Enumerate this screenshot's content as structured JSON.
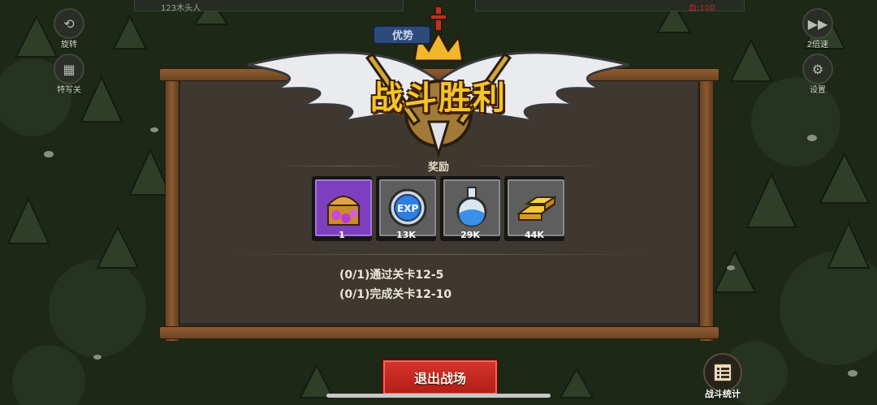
{
  "hud": {
    "player_name": "123木头人",
    "enemy_hp_text": "血:100",
    "left_buttons": [
      {
        "label": "旋转",
        "icon": "rotate-icon"
      },
      {
        "label": "特写关",
        "icon": "film-icon"
      }
    ],
    "right_buttons": [
      {
        "label": "2倍速",
        "icon": "fast-forward-icon"
      },
      {
        "label": "设置",
        "icon": "gear-icon"
      }
    ],
    "banner_text": "优势"
  },
  "victory": {
    "title": "战斗胜利"
  },
  "rewards": {
    "title": "奖励",
    "items": [
      {
        "icon": "treasure-chest-icon",
        "count": "1",
        "frame": "#8d4fd3"
      },
      {
        "icon": "exp-icon",
        "count": "13K",
        "frame": "#6c6c6c"
      },
      {
        "icon": "potion-flask-icon",
        "count": "29K",
        "frame": "#6c6c6c"
      },
      {
        "icon": "gold-bars-icon",
        "count": "44K",
        "frame": "#6c6c6c"
      }
    ]
  },
  "tasks": [
    {
      "text": "(0/1)通过关卡12-5"
    },
    {
      "text": "(0/1)完成关卡12-10"
    }
  ],
  "exit_button": {
    "label": "退出战场",
    "color": "#c8261f"
  },
  "battle_stats": {
    "label": "战斗统计",
    "icon": "list-icon"
  }
}
